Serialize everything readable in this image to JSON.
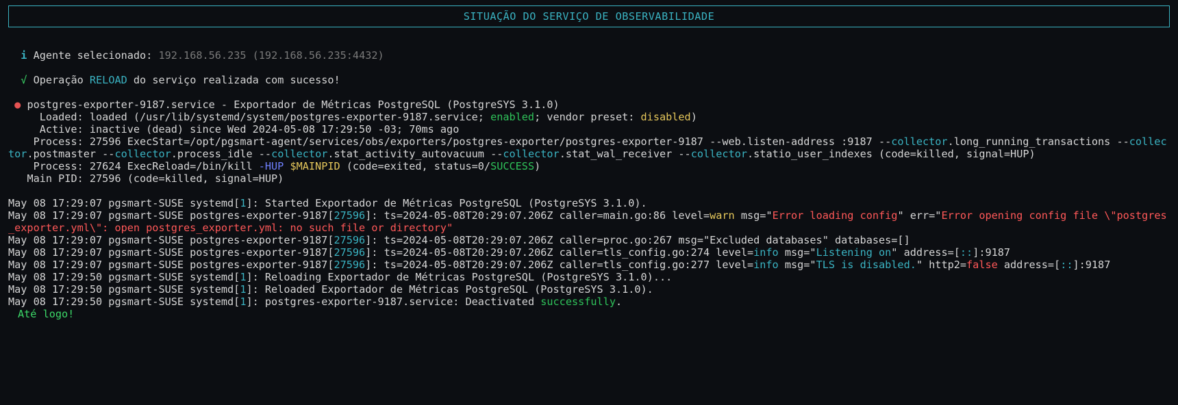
{
  "title": "SITUAÇÃO DO SERVIÇO DE OBSERVABILIDADE",
  "agent_line": {
    "icon": "i",
    "label": "Agente selecionado: ",
    "value": "192.168.56.235 (192.168.56.235:4432)"
  },
  "op_line": {
    "check": "√",
    "p1": " Operação ",
    "reload": "RELOAD",
    "p2": " do serviço realizada com sucesso!"
  },
  "svc": {
    "bullet": "●",
    "name": " postgres-exporter-9187.service - Exportador de Métricas PostgreSQL (PostgreSYS 3.1.0)",
    "loaded_a": "     Loaded: loaded (/usr/lib/systemd/system/postgres-exporter-9187.service; ",
    "enabled": "enabled",
    "loaded_b": "; vendor preset: ",
    "disabled": "disabled",
    "loaded_c": ")",
    "active": "     Active: inactive (dead) since Wed 2024-05-08 17:29:50 -03; 70ms ago",
    "proc1_a": "    Process: 27596 ExecStart=/opt/pgsmart-agent/services/obs/exporters/postgres-exporter/postgres-exporter-9187 --web.listen-address :9187 --",
    "collector": "collector",
    "p1b": ".long_running_transactions --",
    "p1c": ".postmaster --",
    "p1d": ".process_idle --",
    "p1e": ".stat_activity_autovacuum --",
    "p1f": ".stat_wal_receiver --",
    "p1g": ".statio_user_indexes (code=killed, signal=HUP)",
    "proc2_a": "    Process: 27624 ExecReload=/bin/kill ",
    "hup": "-HUP",
    "mainpid": " $MAINPID",
    "proc2_b": " (code=exited, status=0/",
    "success": "SUCCESS",
    "proc2_c": ")",
    "mainp": "   Main PID: 27596 (code=killed, signal=HUP)"
  },
  "logs": {
    "l1a": "May 08 17:29:07 pgsmart-SUSE systemd[",
    "one": "1",
    "l1b": "]: Started Exportador de Métricas PostgreSQL (PostgreSYS 3.1.0).",
    "l2a": "May 08 17:29:07 pgsmart-SUSE postgres-exporter-9187[",
    "pid": "27596",
    "l2b": "]: ts=2024-05-08T20:29:07.206Z caller=main.go:86 level=",
    "warn": "warn",
    "l2c": " msg=\"",
    "errmsg1": "Error loading config",
    "l2d": "\" err=\"",
    "errmsg2": "Error opening config file \\\"postgres_exporter.yml\\\": open postgres_exporter.yml: ",
    "no": "no",
    "l2e": " such file or directory\"",
    "l3a": "May 08 17:29:07 pgsmart-SUSE postgres-exporter-9187[",
    "l3b": "]: ts=2024-05-08T20:29:07.206Z caller=proc.go:267 msg=\"Excluded databases\" databases=[]",
    "l4a": "May 08 17:29:07 pgsmart-SUSE postgres-exporter-9187[",
    "l4b": "]: ts=2024-05-08T20:29:07.206Z caller=tls_config.go:274 level=",
    "info": "info",
    "l4c": " msg=\"",
    "lon": "Listening on",
    "l4d": "\" address=[",
    "cc": "::",
    "l4e": "]:9187",
    "l5a": "May 08 17:29:07 pgsmart-SUSE postgres-exporter-9187[",
    "l5b": "]: ts=2024-05-08T20:29:07.206Z caller=tls_config.go:277 level=",
    "l5c": " msg=\"",
    "tls": "TLS is disabled.",
    "l5d": "\" http2=",
    "false": "false",
    "l5e": " address=[",
    "l5f": "]:9187",
    "l6a": "May 08 17:29:50 pgsmart-SUSE systemd[",
    "l6b": "]: Reloading Exportador de Métricas PostgreSQL (PostgreSYS 3.1.0)...",
    "l7a": "May 08 17:29:50 pgsmart-SUSE systemd[",
    "l7b": "]: Reloaded Exportador de Métricas PostgreSQL (PostgreSYS 3.1.0).",
    "l8a": "May 08 17:29:50 pgsmart-SUSE systemd[",
    "l8b": "]: postgres-exporter-9187.service: Deactivated ",
    "succ2": "successfully",
    "l8c": "."
  },
  "farewell": "Até logo!"
}
